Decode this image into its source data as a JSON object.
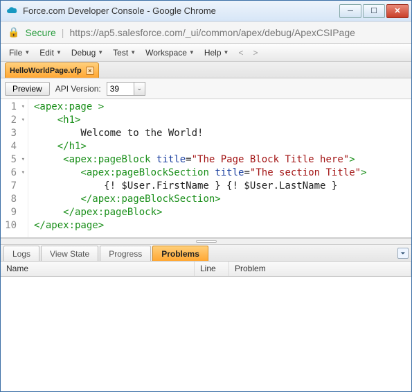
{
  "window": {
    "title": "Force.com Developer Console - Google Chrome"
  },
  "address": {
    "secure_label": "Secure",
    "url": "https://ap5.salesforce.com/_ui/common/apex/debug/ApexCSIPage"
  },
  "menubar": {
    "items": [
      "File",
      "Edit",
      "Debug",
      "Test",
      "Workspace",
      "Help"
    ]
  },
  "file_tab": {
    "name": "HelloWorldPage.vfp"
  },
  "subtoolbar": {
    "preview_label": "Preview",
    "api_version_label": "API Version:",
    "api_version_value": "39"
  },
  "code_lines": [
    {
      "num": "1",
      "foldable": true,
      "segs": [
        [
          "tag",
          "<apex:page "
        ],
        [
          "tag",
          ">"
        ]
      ]
    },
    {
      "num": "2",
      "foldable": true,
      "segs": [
        [
          "plain",
          "    "
        ],
        [
          "tag",
          "<h1>"
        ]
      ]
    },
    {
      "num": "3",
      "foldable": false,
      "segs": [
        [
          "plain",
          "        Welcome to the World!"
        ]
      ]
    },
    {
      "num": "4",
      "foldable": false,
      "segs": [
        [
          "plain",
          "    "
        ],
        [
          "tag",
          "</h1>"
        ]
      ]
    },
    {
      "num": "5",
      "foldable": true,
      "segs": [
        [
          "plain",
          "     "
        ],
        [
          "tag",
          "<apex:pageBlock "
        ],
        [
          "attr",
          "title"
        ],
        [
          "plain",
          "="
        ],
        [
          "str",
          "\"The Page Block Title here\""
        ],
        [
          "tag",
          ">"
        ]
      ]
    },
    {
      "num": "6",
      "foldable": true,
      "segs": [
        [
          "plain",
          "        "
        ],
        [
          "tag",
          "<apex:pageBlockSection "
        ],
        [
          "attr",
          "title"
        ],
        [
          "plain",
          "="
        ],
        [
          "str",
          "\"The section Title\""
        ],
        [
          "tag",
          ">"
        ]
      ]
    },
    {
      "num": "7",
      "foldable": false,
      "segs": [
        [
          "plain",
          "            {! $User.FirstName } {! $User.LastName }"
        ]
      ]
    },
    {
      "num": "8",
      "foldable": false,
      "segs": [
        [
          "plain",
          "        "
        ],
        [
          "tag",
          "</apex:pageBlockSection>"
        ]
      ]
    },
    {
      "num": "9",
      "foldable": false,
      "segs": [
        [
          "plain",
          "     "
        ],
        [
          "tag",
          "</apex:pageBlock>"
        ]
      ]
    },
    {
      "num": "10",
      "foldable": false,
      "segs": [
        [
          "tag",
          "</apex:page>"
        ]
      ]
    }
  ],
  "bottom_panel": {
    "tabs": [
      "Logs",
      "View State",
      "Progress",
      "Problems"
    ],
    "active_tab": "Problems",
    "columns": {
      "name": "Name",
      "line": "Line",
      "problem": "Problem"
    }
  }
}
